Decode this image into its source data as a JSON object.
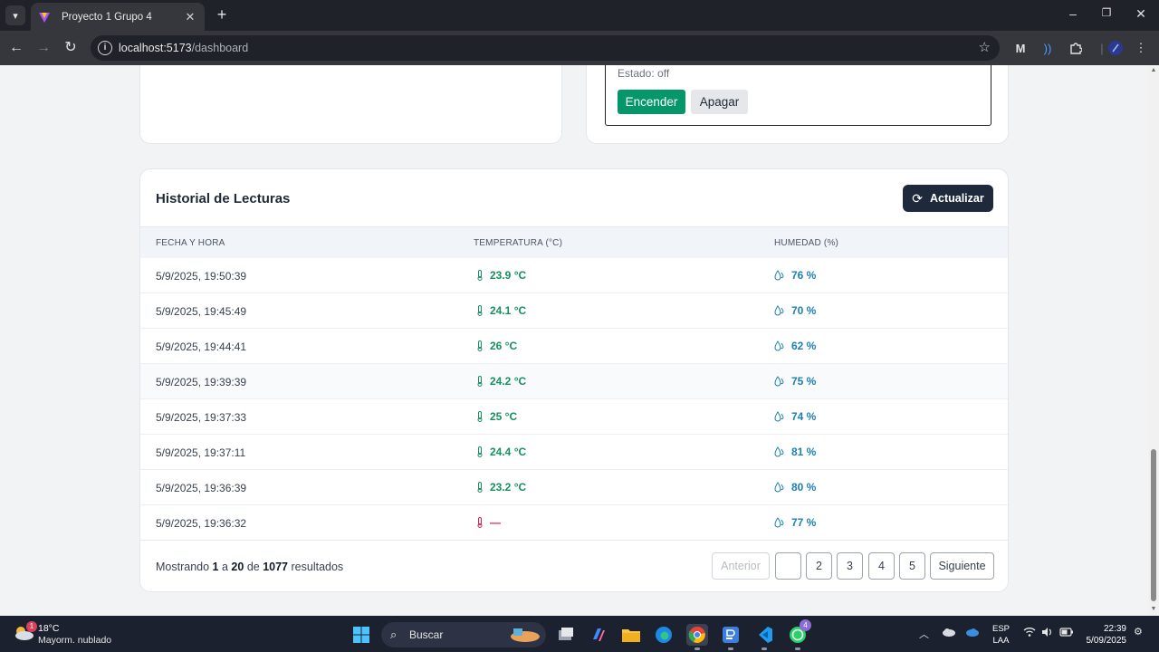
{
  "browser": {
    "tab_title": "Proyecto 1 Grupo 4",
    "url_host": "localhost:5173",
    "url_path": "/dashboard"
  },
  "device": {
    "status_label": "Estado: off",
    "on_label": "Encender",
    "off_label": "Apagar"
  },
  "history": {
    "title": "Historial de Lecturas",
    "refresh_label": "Actualizar",
    "columns": [
      "FECHA Y HORA",
      "TEMPERATURA (°C)",
      "HUMEDAD (%)"
    ],
    "rows": [
      {
        "date": "5/9/2025, 19:50:39",
        "temp": "23.9 °C",
        "hum": "76 %"
      },
      {
        "date": "5/9/2025, 19:45:49",
        "temp": "24.1 °C",
        "hum": "70 %"
      },
      {
        "date": "5/9/2025, 19:44:41",
        "temp": "26 °C",
        "hum": "62 %"
      },
      {
        "date": "5/9/2025, 19:39:39",
        "temp": "24.2 °C",
        "hum": "75 %"
      },
      {
        "date": "5/9/2025, 19:37:33",
        "temp": "25 °C",
        "hum": "74 %"
      },
      {
        "date": "5/9/2025, 19:37:11",
        "temp": "24.4 °C",
        "hum": "81 %"
      },
      {
        "date": "5/9/2025, 19:36:39",
        "temp": "23.2 °C",
        "hum": "80 %"
      },
      {
        "date": "5/9/2025, 19:36:32",
        "temp": "—",
        "hum": "77 %"
      }
    ],
    "summary": {
      "prefix": "Mostrando",
      "from": "1",
      "to_word": "a",
      "to": "20",
      "of_word": "de",
      "total": "1077",
      "suffix": "resultados"
    },
    "pagination": {
      "prev": "Anterior",
      "pages": [
        "",
        "2",
        "3",
        "4",
        "5"
      ],
      "next": "Siguiente"
    }
  },
  "taskbar": {
    "weather_temp": "18°C",
    "weather_desc": "Mayorm. nublado",
    "weather_badge": "1",
    "search_label": "Buscar",
    "whatsapp_badge": "4",
    "lang_top": "ESP",
    "lang_bottom": "LAA",
    "time": "22:39",
    "date": "5/09/2025"
  }
}
